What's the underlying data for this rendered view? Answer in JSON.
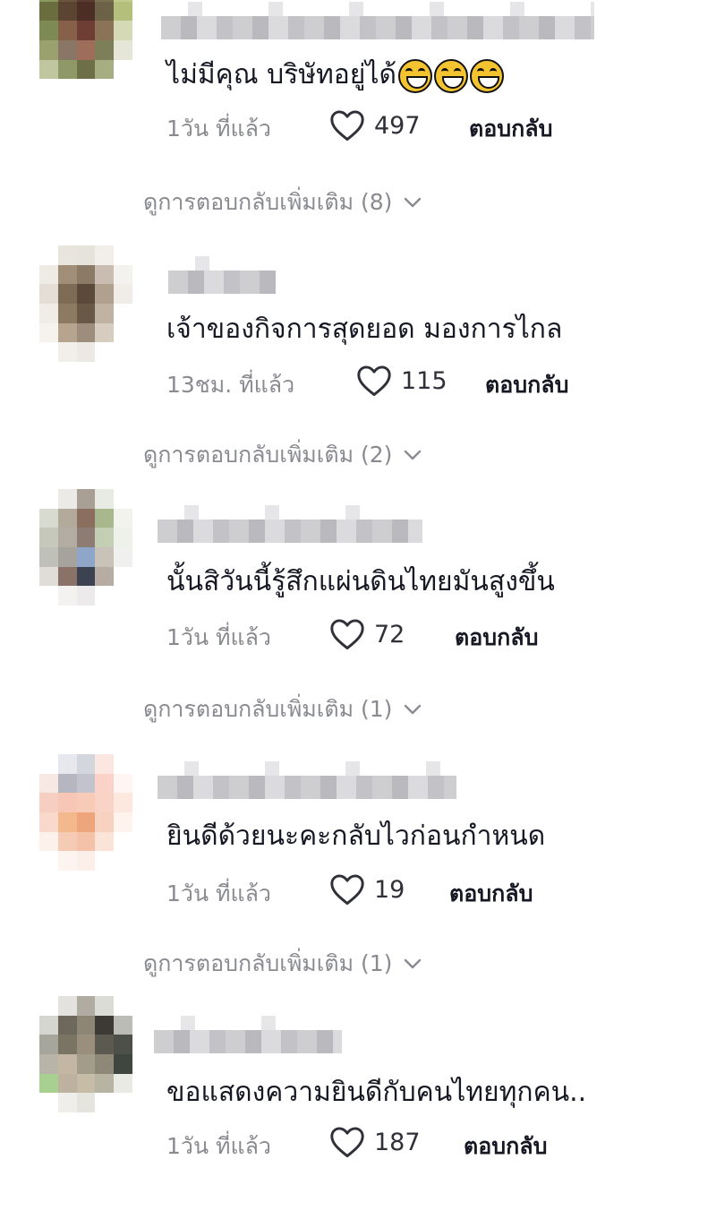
{
  "comments": [
    {
      "text": "ไม่มีคุณ บริษัทอยู่ได้",
      "emoji": [
        "laugh-cry-emoji",
        "laugh-cry-emoji",
        "laugh-cry-emoji"
      ],
      "time": "1วัน ที่แล้ว",
      "likes": "497",
      "reply_label": "ตอบกลับ",
      "more_replies": "ดูการตอบกลับเพิ่มเติม (8)"
    },
    {
      "text": "เจ้าของกิจการสุดยอด มองการไกล",
      "time": "13ชม. ที่แล้ว",
      "likes": "115",
      "reply_label": "ตอบกลับ",
      "more_replies": "ดูการตอบกลับเพิ่มเติม (2)"
    },
    {
      "text": "นั้นสิวันนี้รู้สึกแผ่นดินไทยมันสูงขึ้น",
      "time": "1วัน ที่แล้ว",
      "likes": "72",
      "reply_label": "ตอบกลับ",
      "more_replies": "ดูการตอบกลับเพิ่มเติม (1)"
    },
    {
      "text": "ยินดีด้วยนะคะกลับไวก่อนกำหนด",
      "time": "1วัน ที่แล้ว",
      "likes": "19",
      "reply_label": "ตอบกลับ",
      "more_replies": "ดูการตอบกลับเพิ่มเติม (1)"
    },
    {
      "text": "ขอแสดงความยินดีกับคนไทยทุกคน..",
      "time": "1วัน ที่แล้ว",
      "likes": "187",
      "reply_label": "ตอบกลับ"
    }
  ],
  "icons": {
    "like": "heart-outline-icon",
    "expand": "chevron-down-icon"
  },
  "colors": {
    "text": "#161823",
    "muted": "#8a8b91"
  }
}
